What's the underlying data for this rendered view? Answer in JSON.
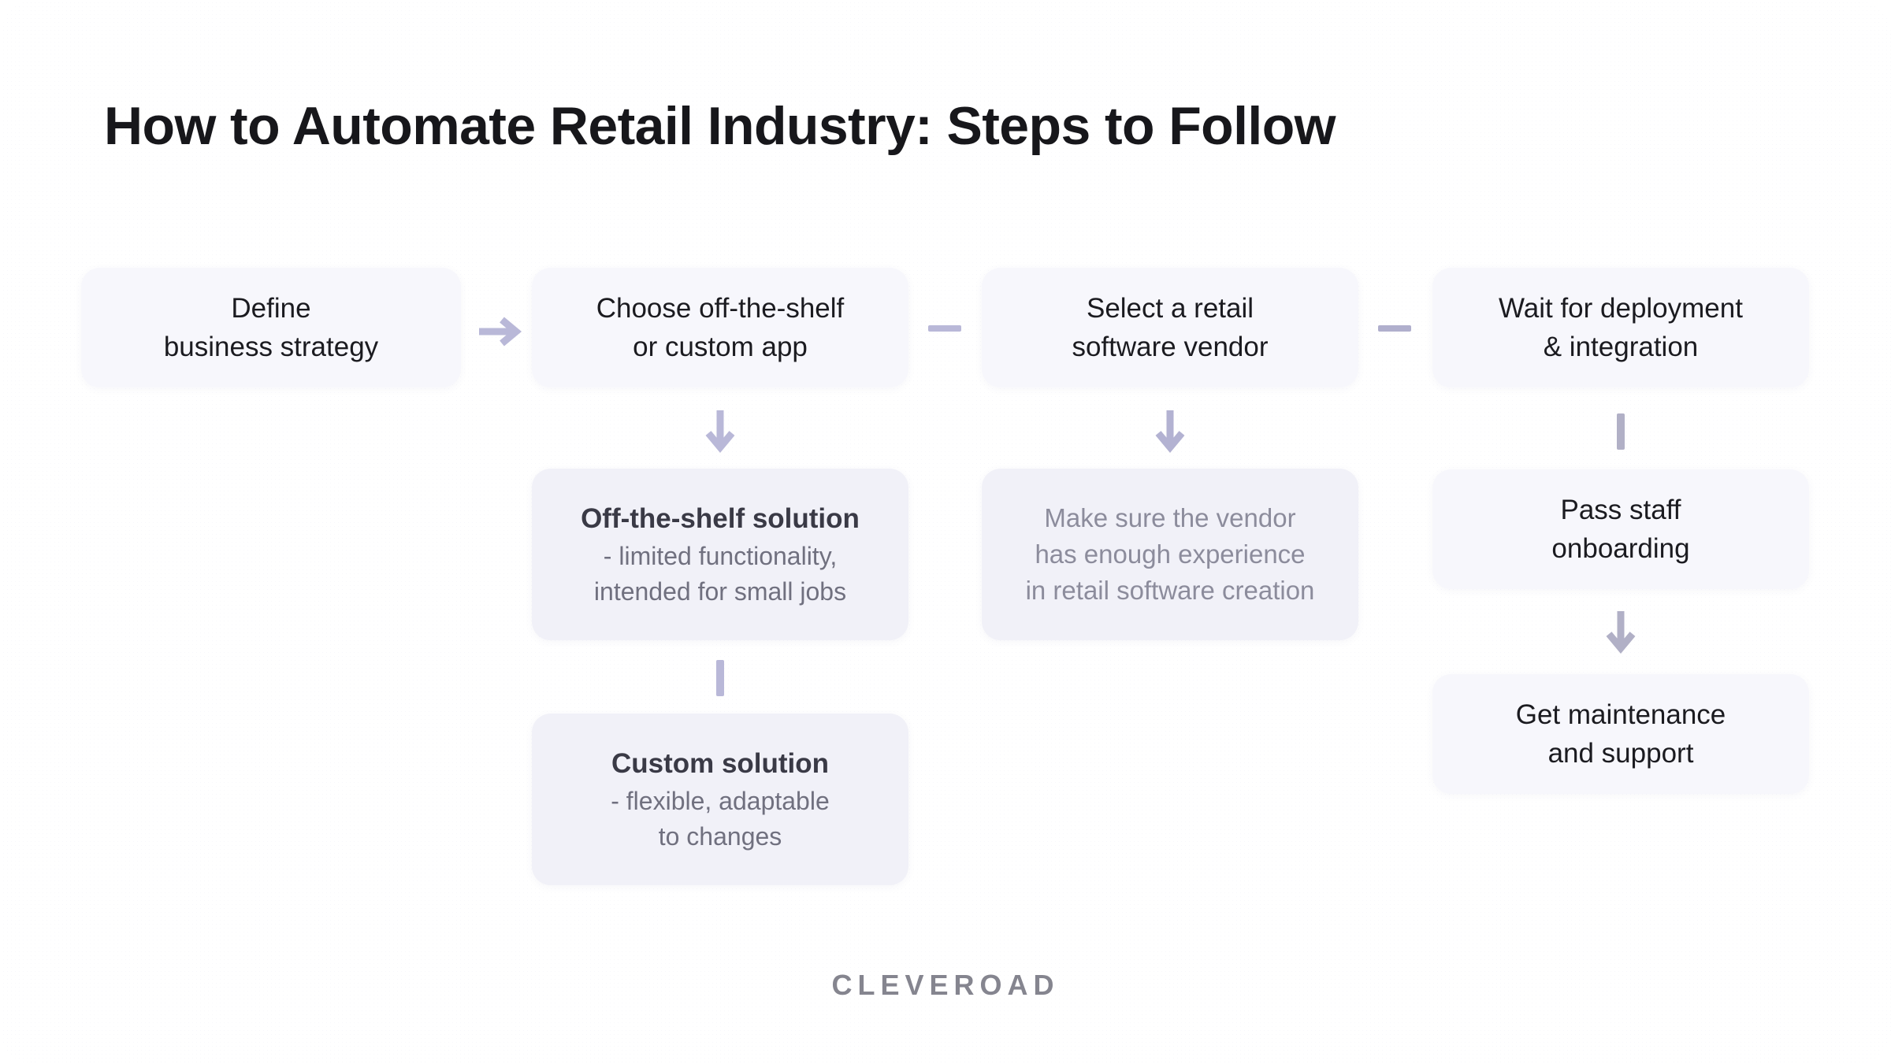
{
  "title": "How to Automate Retail Industry: Steps to Follow",
  "footer": {
    "logo": "CLEVEROAD"
  },
  "colors": {
    "card_bg_light": "#f5f5fb",
    "card_bg_purple": "#c7c5ea",
    "box_bg": "#f7f7fc",
    "box_bg_soft": "#f1f1f8",
    "text_dark": "#1b1b20",
    "text_muted": "#70707f",
    "text_faded": "#8c8c9c",
    "connector": "#b9b8d8",
    "connector_gray": "#b5b5c4",
    "logo": "#85858f"
  },
  "flow": {
    "row1": [
      {
        "id": "define-business-strategy",
        "lines": [
          "Define",
          "business strategy"
        ]
      },
      {
        "id": "choose-off-the-shelf-or-custom-app",
        "lines": [
          "Choose off-the-shelf",
          "or custom app"
        ]
      },
      {
        "id": "select-a-retail-software-vendor",
        "lines": [
          "Select a retail",
          "software vendor"
        ]
      },
      {
        "id": "wait-for-deployment-and-integration",
        "lines": [
          "Wait for deployment",
          "& integration"
        ]
      }
    ],
    "off_the_shelf": {
      "id": "off-the-shelf-solution",
      "heading": "Off-the-shelf solution",
      "sub": [
        "- limited functionality,",
        "intended for small jobs"
      ]
    },
    "custom": {
      "id": "custom-solution",
      "heading": "Custom solution",
      "sub": [
        "- flexible, adaptable",
        "to changes"
      ]
    },
    "vendor_note": {
      "id": "vendor-experience-note",
      "lines": [
        "Make sure the vendor",
        "has enough experience",
        "in retail software creation"
      ]
    },
    "pass_staff_onboarding": {
      "id": "pass-staff-onboarding",
      "lines": [
        "Pass staff",
        "onboarding"
      ]
    },
    "get_maintenance": {
      "id": "get-maintenance-and-support",
      "lines": [
        "Get maintenance",
        "and support"
      ]
    }
  },
  "connectors": [
    {
      "id": "arrow-right-strategy-to-choose",
      "type": "arrow-right"
    },
    {
      "id": "dash-choose-to-vendor",
      "type": "dash"
    },
    {
      "id": "dash-vendor-to-deployment",
      "type": "dash"
    },
    {
      "id": "arrow-down-choose-to-offtheshelf",
      "type": "arrow-down"
    },
    {
      "id": "arrow-down-vendor-to-note",
      "type": "arrow-down"
    },
    {
      "id": "bar-deployment-to-onboarding",
      "type": "bar"
    },
    {
      "id": "bar-offtheshelf-to-custom",
      "type": "bar"
    },
    {
      "id": "arrow-down-onboarding-to-maintenance",
      "type": "arrow-down"
    }
  ]
}
